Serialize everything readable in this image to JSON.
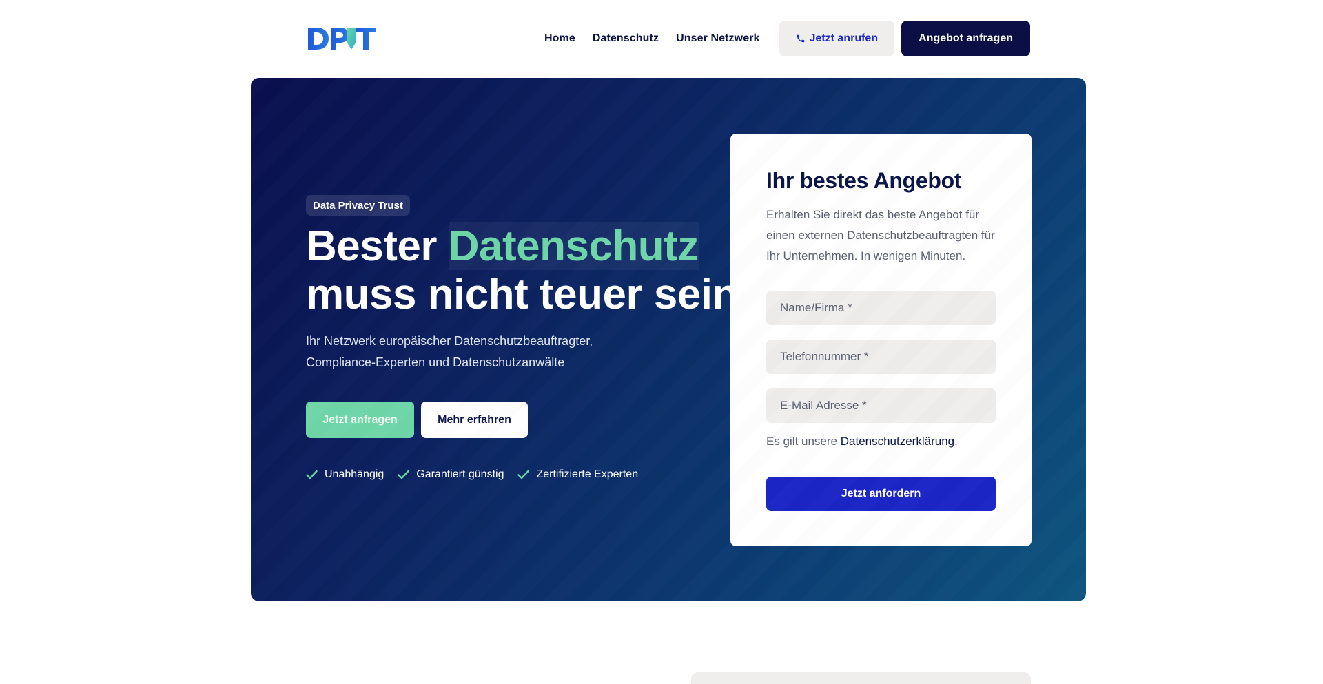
{
  "header": {
    "logo_text": "DPT",
    "nav": [
      "Home",
      "Datenschutz",
      "Unser Netzwerk"
    ],
    "call_label": "Jetzt anrufen",
    "offer_label": "Angebot anfragen"
  },
  "hero": {
    "badge": "Data Privacy Trust",
    "headline_part1": "Bester ",
    "headline_accent": "Datenschutz",
    "headline_line2": "muss nicht teuer sein",
    "subtext": "Ihr Netzwerk europäischer Datenschutzbeauftragter, Compliance-Experten und Datenschutzanwälte",
    "primary_button": "Jetzt anfragen",
    "secondary_button": "Mehr erfahren",
    "features": [
      "Unabhängig",
      "Garantiert günstig",
      "Zertifizierte Experten"
    ]
  },
  "form": {
    "title": "Ihr bestes Angebot",
    "description": "Erhalten Sie direkt das beste Angebot für einen externen Datenschutzbeauftragten für Ihr Unternehmen. In wenigen Minuten.",
    "name_placeholder": "Name/Firma *",
    "phone_placeholder": "Telefonnummer *",
    "email_placeholder": "E-Mail Adresse *",
    "privacy_prefix": "Es gilt unsere ",
    "privacy_link": "Datenschutzerklärung",
    "privacy_suffix": ".",
    "submit_label": "Jetzt anfordern"
  },
  "colors": {
    "navy": "#0b0f45",
    "accent_green": "#6ed6a8",
    "submit_blue": "#1b25c6",
    "light_gray": "#efeeec"
  },
  "icons": [
    "phone-icon",
    "check-icon",
    "logo-shield-icon"
  ]
}
